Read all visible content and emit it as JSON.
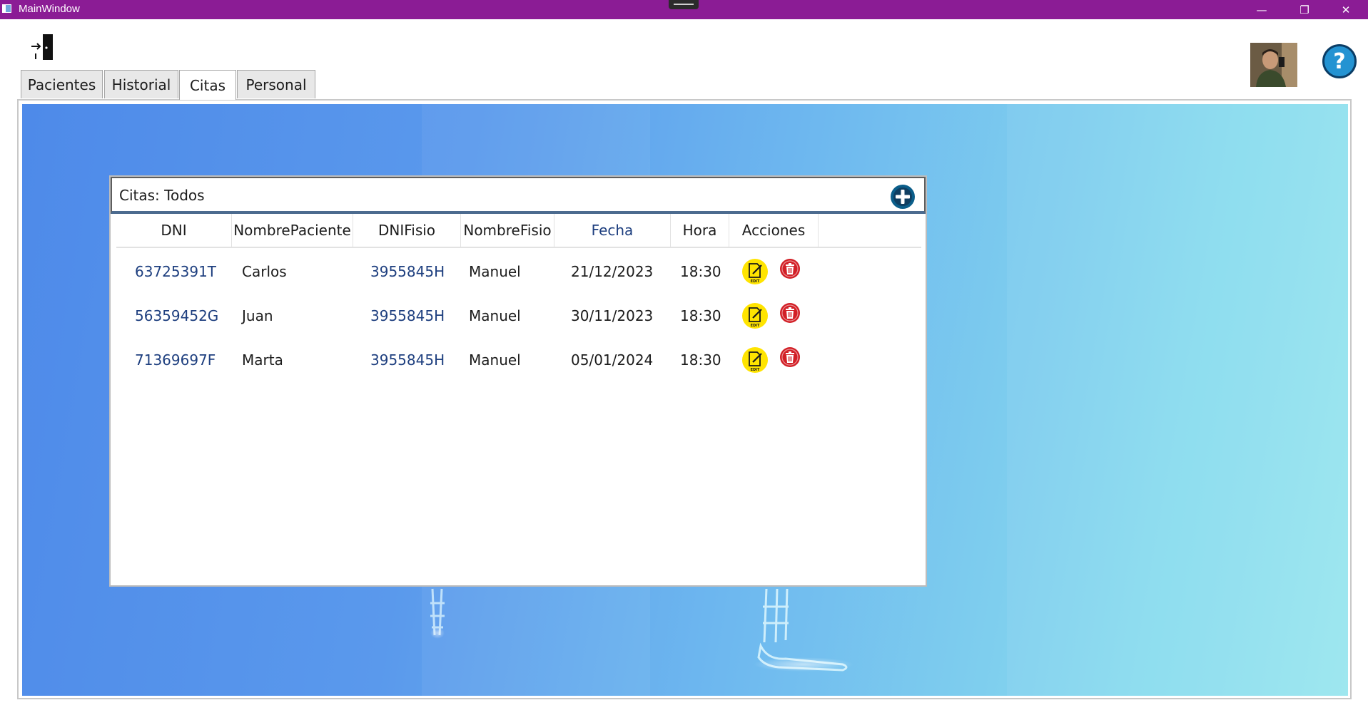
{
  "window": {
    "title": "MainWindow",
    "minimize_glyph": "—",
    "restore_glyph": "❐",
    "close_glyph": "✕"
  },
  "help": {
    "glyph": "?"
  },
  "tabs": [
    {
      "label": "Pacientes",
      "active": false
    },
    {
      "label": "Historial",
      "active": false
    },
    {
      "label": "Citas",
      "active": true
    },
    {
      "label": "Personal",
      "active": false
    }
  ],
  "panel": {
    "title": "Citas: Todos",
    "columns": [
      "DNI",
      "NombrePaciente",
      "DNIFisio",
      "NombreFisio",
      "Fecha",
      "Hora",
      "Acciones"
    ],
    "sorted_column": "Fecha",
    "rows": [
      {
        "dni": "63725391T",
        "nombre_paciente": "Carlos",
        "dni_fisio": "3955845H",
        "nombre_fisio": "Manuel",
        "fecha": "21/12/2023",
        "hora": "18:30"
      },
      {
        "dni": "56359452G",
        "nombre_paciente": "Juan",
        "dni_fisio": "3955845H",
        "nombre_fisio": "Manuel",
        "fecha": "30/11/2023",
        "hora": "18:30"
      },
      {
        "dni": "71369697F",
        "nombre_paciente": "Marta",
        "dni_fisio": "3955845H",
        "nombre_fisio": "Manuel",
        "fecha": "05/01/2024",
        "hora": "18:30"
      }
    ],
    "edit_icon_text": "EDIT"
  },
  "colors": {
    "titlebar": "#8b1c95",
    "link_text": "#1e3f7f",
    "add_button": "#0b5e8a",
    "edit_button": "#ffe400",
    "delete_button": "#d21f26",
    "help_button": "#2493d2"
  },
  "icons": {
    "exit": "door-exit-icon",
    "add": "plus-circle-icon",
    "edit": "edit-document-icon",
    "delete": "trash-icon",
    "help": "question-mark-icon"
  }
}
